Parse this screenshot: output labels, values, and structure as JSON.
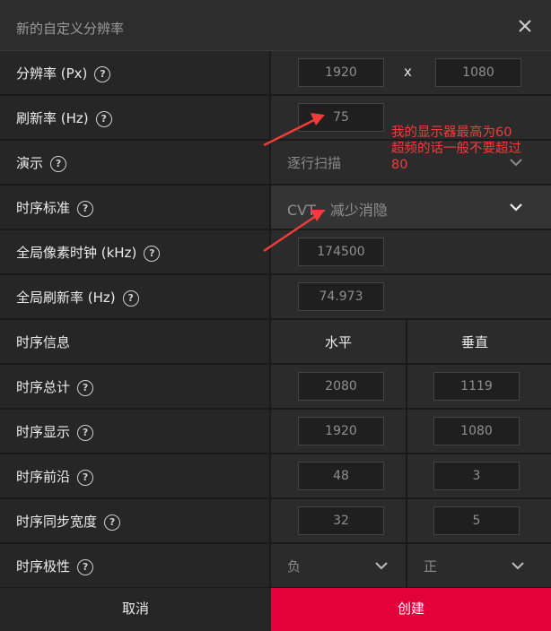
{
  "dialog": {
    "title": "新的自定义分辨率",
    "close_icon": "close-icon"
  },
  "resolution": {
    "label": "分辨率 (Px)",
    "width": "1920",
    "separator": "x",
    "height": "1080"
  },
  "refresh": {
    "label": "刷新率 (Hz)",
    "value": "75"
  },
  "scan": {
    "label": "演示",
    "value": "逐行扫描"
  },
  "timing_standard": {
    "label": "时序标准",
    "value": "CVT - 减少消隐"
  },
  "pixel_clock": {
    "label": "全局像素时钟 (kHz)",
    "value": "174500"
  },
  "global_refresh": {
    "label": "全局刷新率 (Hz)",
    "value": "74.973"
  },
  "timing_info": {
    "label": "时序信息",
    "horizontal": "水平",
    "vertical": "垂直"
  },
  "timing_total": {
    "label": "时序总计",
    "h": "2080",
    "v": "1119"
  },
  "timing_display": {
    "label": "时序显示",
    "h": "1920",
    "v": "1080"
  },
  "front_porch": {
    "label": "时序前沿",
    "h": "48",
    "v": "3"
  },
  "sync_width": {
    "label": "时序同步宽度",
    "h": "32",
    "v": "5"
  },
  "polarity": {
    "label": "时序极性",
    "h": "负",
    "v": "正"
  },
  "footer": {
    "cancel": "取消",
    "create": "创建"
  },
  "annotation": {
    "line1": "我的显示器最高为60",
    "line2": "超频的话一般不要超过",
    "line3": "80",
    "color": "#f43b3b"
  },
  "colors": {
    "accent": "#e4003a"
  }
}
